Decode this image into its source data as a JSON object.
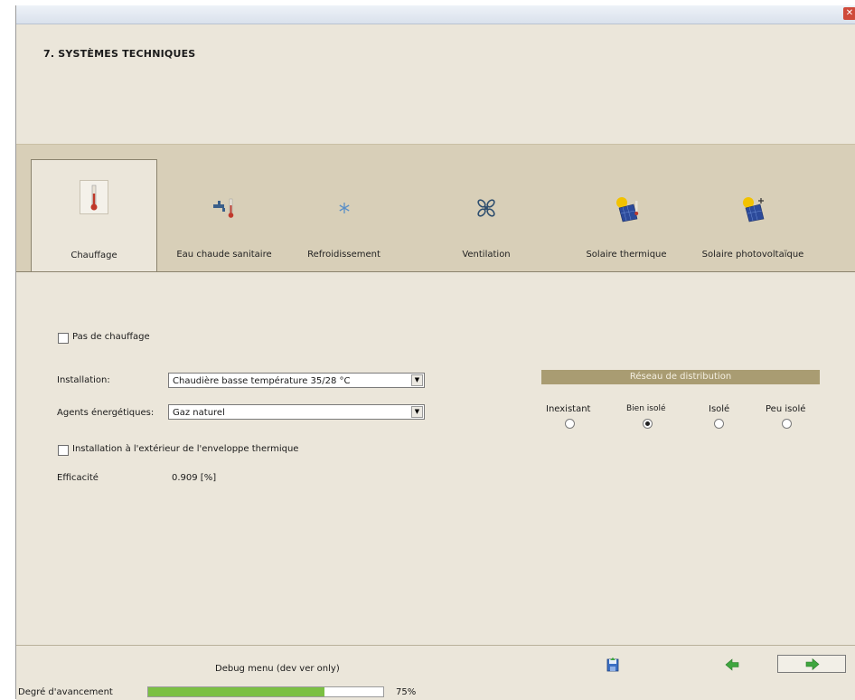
{
  "header": {
    "title": "7. SYSTÈMES TECHNIQUES"
  },
  "tabs": [
    {
      "label": "Chauffage",
      "icon": "thermometer-icon",
      "active": true
    },
    {
      "label": "Eau chaude sanitaire",
      "icon": "faucet-icon",
      "active": false
    },
    {
      "label": "Refroidissement",
      "icon": "snowflake-icon",
      "active": false
    },
    {
      "label": "Ventilation",
      "icon": "fan-icon",
      "active": false
    },
    {
      "label": "Solaire thermique",
      "icon": "solar-thermal-icon",
      "active": false
    },
    {
      "label": "Solaire photovoltaïque",
      "icon": "solar-pv-icon",
      "active": false
    }
  ],
  "form": {
    "no_heating_label": "Pas de chauffage",
    "installation_label": "Installation:",
    "installation_value": "Chaudière basse température 35/28 °C",
    "agents_label": "Agents énergétiques:",
    "agents_value": "Gaz naturel",
    "exterior_label": "Installation à l'extérieur de l'enveloppe thermique",
    "efficiency_label": "Efficacité",
    "efficiency_value": "0.909  [%]"
  },
  "distribution": {
    "title": "Réseau de distribution",
    "options": [
      {
        "label": "Inexistant",
        "selected": false
      },
      {
        "label": "Bien isolé",
        "selected": true
      },
      {
        "label": "Isolé",
        "selected": false
      },
      {
        "label": "Peu isolé",
        "selected": false
      }
    ]
  },
  "footer": {
    "debug_menu": "Debug menu (dev ver only)",
    "progress_label": "Degré d'avancement",
    "progress_value": 0.75,
    "progress_text": "75%"
  },
  "colors": {
    "background": "#ebe6da",
    "tabbar": "#d8cfb8",
    "accent": "#a99c72",
    "progress": "#7bc043"
  }
}
